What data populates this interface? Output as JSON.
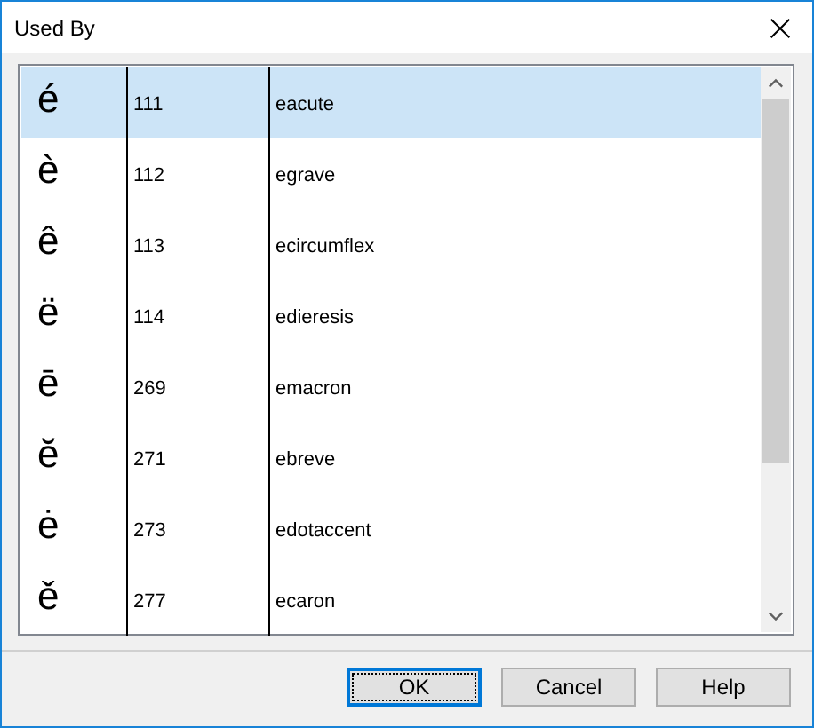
{
  "window": {
    "title": "Used By"
  },
  "list": {
    "rows": [
      {
        "glyph": "é",
        "code": "111",
        "name": "eacute",
        "selected": true
      },
      {
        "glyph": "è",
        "code": "112",
        "name": "egrave",
        "selected": false
      },
      {
        "glyph": "ê",
        "code": "113",
        "name": "ecircumflex",
        "selected": false
      },
      {
        "glyph": "ë",
        "code": "114",
        "name": "edieresis",
        "selected": false
      },
      {
        "glyph": "ē",
        "code": "269",
        "name": "emacron",
        "selected": false
      },
      {
        "glyph": "ĕ",
        "code": "271",
        "name": "ebreve",
        "selected": false
      },
      {
        "glyph": "ė",
        "code": "273",
        "name": "edotaccent",
        "selected": false
      },
      {
        "glyph": "ě",
        "code": "277",
        "name": "ecaron",
        "selected": false
      }
    ]
  },
  "buttons": [
    {
      "label": "OK",
      "focused": true
    },
    {
      "label": "Cancel",
      "focused": false
    },
    {
      "label": "Help",
      "focused": false
    }
  ]
}
